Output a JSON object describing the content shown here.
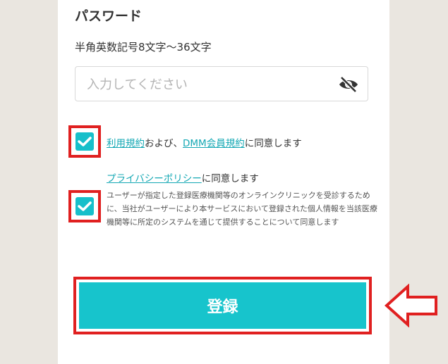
{
  "password": {
    "title": "パスワード",
    "hint": "半角英数記号8文字〜36文字",
    "placeholder": "入力してください",
    "visibility_icon": "eye-off-icon"
  },
  "terms": {
    "link1": "利用規約",
    "between": "および、",
    "link2": "DMM会員規約",
    "suffix": "に同意します",
    "checked": true
  },
  "privacy": {
    "link": "プライバシーポリシー",
    "suffix": "に同意します",
    "body": "ユーザーが指定した登録医療機関等のオンラインクリニックを受診するために、当社がユーザーにより本サービスにおいて登録された個人情報を当該医療機関等に所定のシステムを通じて提供することについて同意します",
    "checked": true
  },
  "register": {
    "label": "登録"
  },
  "colors": {
    "accent": "#17c4cc",
    "highlight": "#e02020",
    "link": "#14a8b4"
  }
}
